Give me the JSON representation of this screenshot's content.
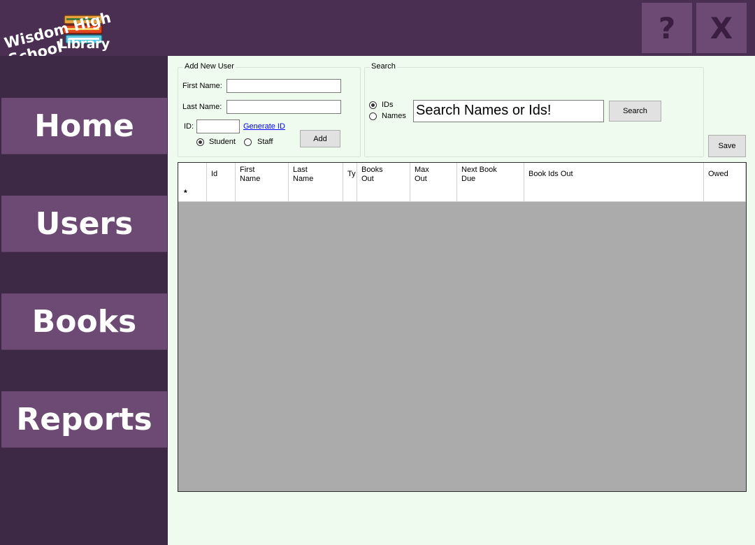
{
  "app": {
    "logo_title": "Wisdom High School",
    "logo_subtitle": "Library",
    "help_label": "?",
    "close_label": "X"
  },
  "nav": {
    "items": [
      {
        "label": "Home"
      },
      {
        "label": "Users"
      },
      {
        "label": "Books"
      },
      {
        "label": "Reports"
      }
    ]
  },
  "add_user": {
    "legend": "Add New User",
    "first_name_label": "First Name:",
    "first_name_value": "",
    "last_name_label": "Last Name:",
    "last_name_value": "",
    "id_label": "ID:",
    "id_value": "",
    "generate_id_label": "Generate ID",
    "add_label": "Add",
    "type_options": [
      {
        "label": "Student",
        "checked": true
      },
      {
        "label": "Staff",
        "checked": false
      }
    ]
  },
  "search": {
    "legend": "Search",
    "mode_options": [
      {
        "label": "IDs",
        "checked": true
      },
      {
        "label": "Names",
        "checked": false
      }
    ],
    "input_value": "Search Names or Ids!",
    "button_label": "Search"
  },
  "save_label": "Save",
  "grid": {
    "columns": [
      "",
      "Id",
      "First\nName",
      "Last\nName",
      "Ty",
      "Books\nOut",
      "Max\nOut",
      "Next Book\nDue",
      "Book Ids Out",
      "Owed"
    ],
    "new_row_marker": "*"
  },
  "colors": {
    "header_bg": "#4a2f52",
    "sidebar_bg": "#3d2845",
    "button_bg": "#6c4a74",
    "content_bg": "#effbef",
    "grid_empty_bg": "#ababab"
  },
  "icons": {
    "logo": "stacked-books-icon"
  }
}
